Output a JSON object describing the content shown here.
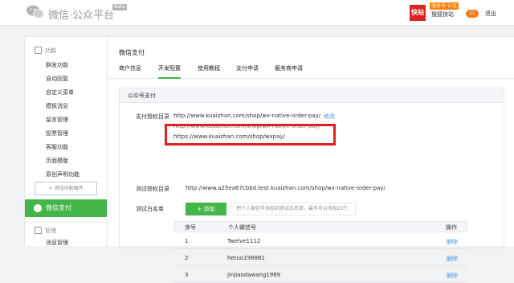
{
  "header": {
    "brand": "微信·公众平台",
    "beta": "Beta",
    "account_avatar_text": "快站",
    "account_tag": "服务号·认证",
    "account_name": "搜狐快站",
    "message_count": "11",
    "logout": "退出"
  },
  "sidebar": {
    "function_title": "功能",
    "function_items": [
      "群发功能",
      "自动回复",
      "自定义菜单",
      "模板消息",
      "留言管理",
      "投票管理",
      "客服功能",
      "页面模版",
      "原创声明功能"
    ],
    "add_plugin": "+ 添加功能插件",
    "active_item": "微信支付",
    "manage_title": "管理",
    "manage_items": [
      "消息管理"
    ]
  },
  "main": {
    "title": "微信支付",
    "tabs": [
      "商户信息",
      "开发配置",
      "使用教程",
      "支付申请",
      "服务商申请"
    ],
    "active_tab": "开发配置",
    "panel_title": "公众号支付",
    "pay_dir_label": "支付授权目录",
    "pay_dir_url": "http://www.kuaizhan.com/shop/wx-native-order-pay/",
    "modify": "修改",
    "pay_dir_url2": "http://www.kuaizhan.com/shop/wx-native-order-pay/",
    "pay_dir_url3": "https://www.kuaizhan.com/shop/wxpay/",
    "test_dir_label": "测试授权目录",
    "test_dir_url": "http://www.a25ea67cbbd.test.kuaizhan.com/shop/wx-native-order-pay/",
    "whitelist_label": "测试白名单",
    "add_button": "+ 添加",
    "add_hint": "把个人微信号添加到测试白名单，最多可以添加20个",
    "table": {
      "headers": [
        "序号",
        "个人微信号",
        "操作"
      ],
      "rows": [
        {
          "no": "1",
          "id": "Twelve1112",
          "action": "删除"
        },
        {
          "no": "2",
          "id": "hetuo198881",
          "action": "删除"
        },
        {
          "no": "3",
          "id": "jinjiaodawang1989",
          "action": "删除"
        }
      ]
    }
  },
  "colors": {
    "accent": "#44b549",
    "highlight": "#e02020",
    "link": "#459ae9"
  }
}
